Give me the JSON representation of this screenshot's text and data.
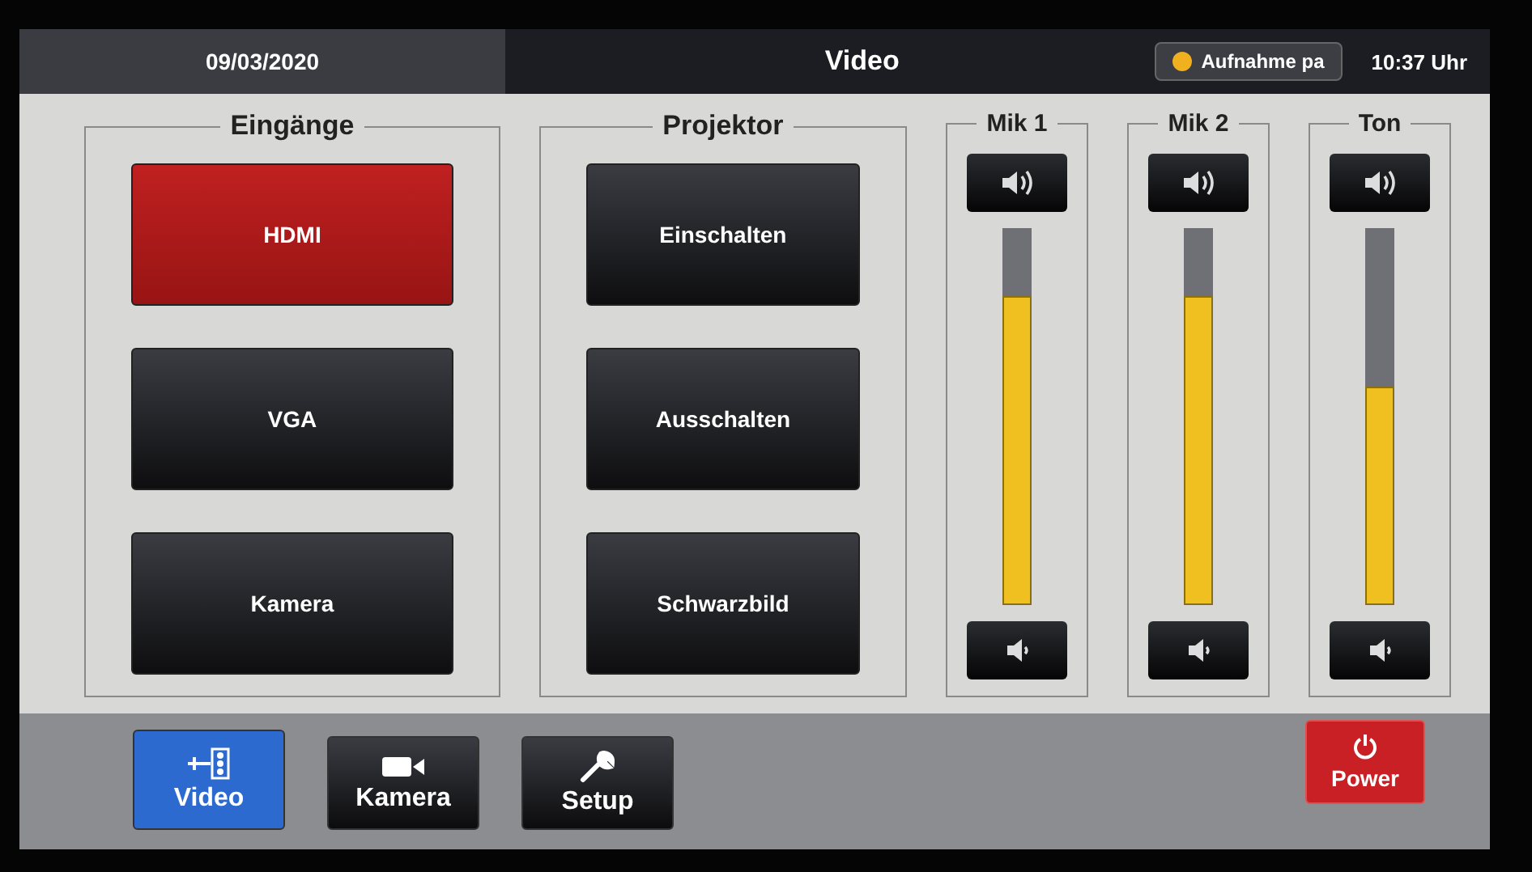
{
  "header": {
    "date": "09/03/2020",
    "title": "Video",
    "status": {
      "label": "Aufnahme pa",
      "color": "#f0b020"
    },
    "time": "10:37 Uhr"
  },
  "inputs": {
    "title": "Eingänge",
    "items": [
      {
        "label": "HDMI",
        "selected": true
      },
      {
        "label": "VGA",
        "selected": false
      },
      {
        "label": "Kamera",
        "selected": false
      }
    ]
  },
  "projector": {
    "title": "Projektor",
    "buttons": [
      "Einschalten",
      "Ausschalten",
      "Schwarzbild"
    ]
  },
  "channels": [
    {
      "name": "Mik 1",
      "level": 0.82
    },
    {
      "name": "Mik 2",
      "level": 0.82
    },
    {
      "name": "Ton",
      "level": 0.58
    }
  ],
  "nav": [
    {
      "label": "Video",
      "selected": true
    },
    {
      "label": "Kamera",
      "selected": false
    },
    {
      "label": "Setup",
      "selected": false
    }
  ],
  "power": {
    "label": "Power"
  }
}
